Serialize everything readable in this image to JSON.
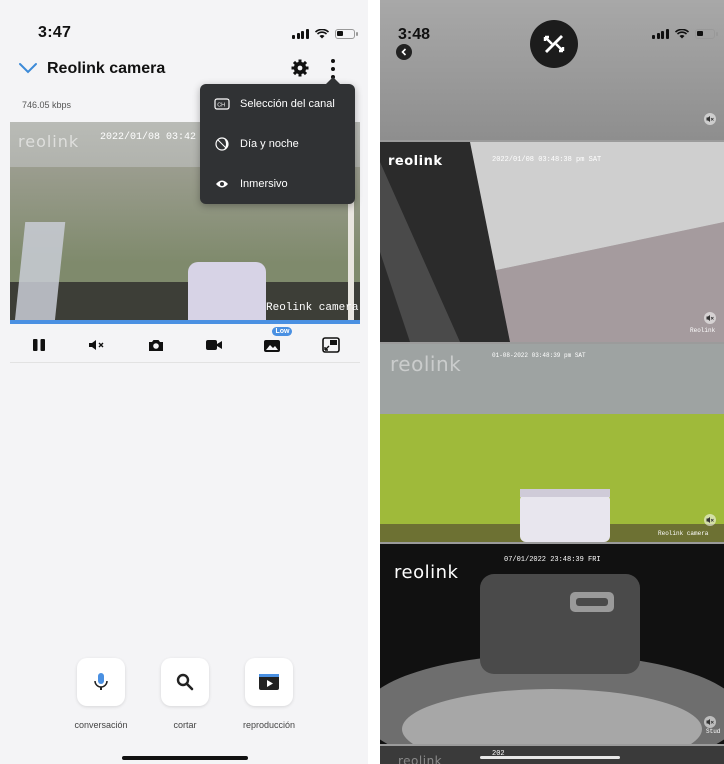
{
  "left": {
    "status": {
      "time": "3:47"
    },
    "header": {
      "title": "Reolink camera"
    },
    "bitrate": "746.05 kbps",
    "video": {
      "logo": "reolink",
      "timestamp": "2022/01/08 03:42",
      "camera_label": "Reolink camera"
    },
    "toolbar": {
      "low_badge": "Low"
    },
    "menu": [
      {
        "label": "Selección del canal",
        "icon": "channel-icon"
      },
      {
        "label": "Día y noche",
        "icon": "day-night-icon"
      },
      {
        "label": "Inmersivo",
        "icon": "eye-icon"
      }
    ],
    "actions": [
      {
        "label": "conversación",
        "icon": "microphone-icon"
      },
      {
        "label": "cortar",
        "icon": "search-icon"
      },
      {
        "label": "reproducción",
        "icon": "playback-icon"
      }
    ]
  },
  "right": {
    "status": {
      "time": "3:48"
    },
    "feeds": [
      {
        "logo": "reolink",
        "timestamp": "2022/01/08 03:48:38 pm SAT",
        "name": "Reolink"
      },
      {
        "logo": "reolink",
        "timestamp": "01-08-2022 03:48:39 pm SAT",
        "name": "Reolink camera"
      },
      {
        "logo": "reolink",
        "timestamp": "07/01/2022 23:48:39 FRI",
        "name": "Stud"
      },
      {
        "logo": "reolink",
        "timestamp": "202",
        "name": ""
      }
    ]
  },
  "colors": {
    "accent": "#4a90e2",
    "menu_bg": "#303234"
  }
}
